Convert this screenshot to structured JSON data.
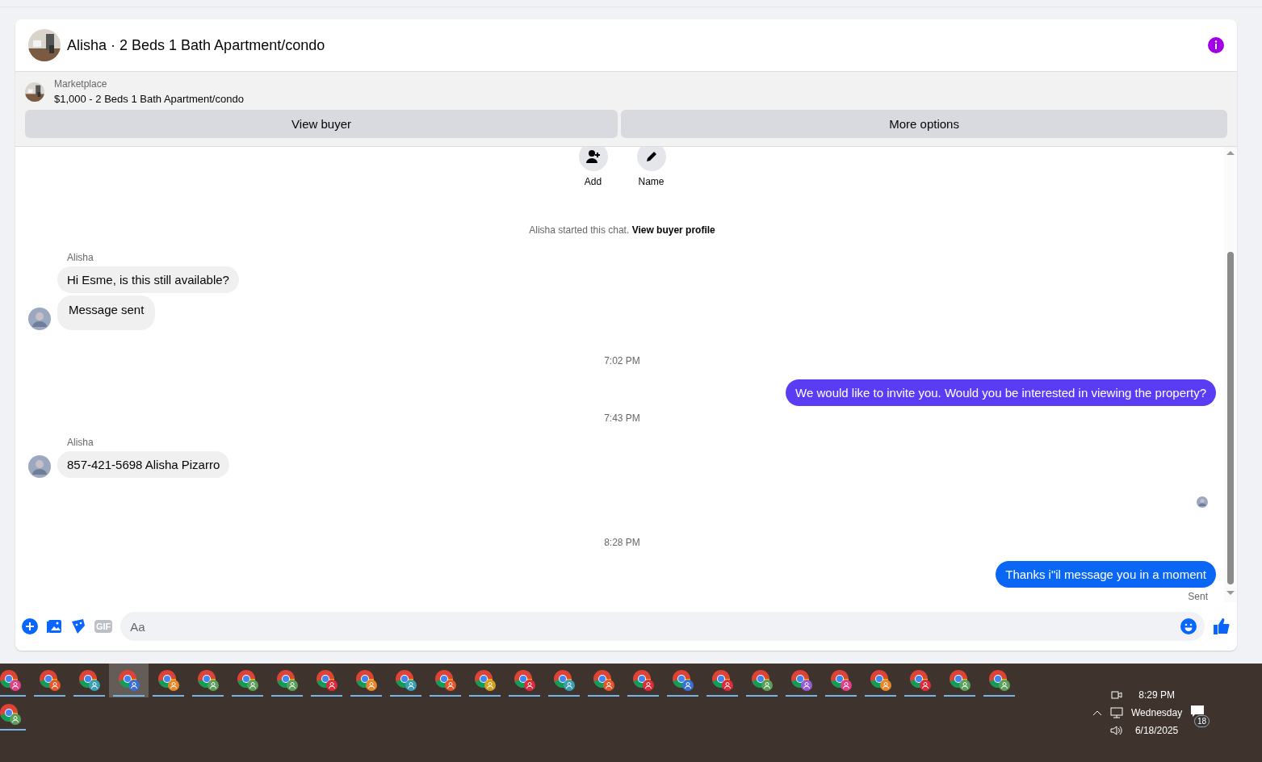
{
  "header": {
    "title": "Alisha · 2 Beds 1 Bath Apartment/condo"
  },
  "listing": {
    "source": "Marketplace",
    "summary": "$1,000 - 2 Beds 1 Bath Apartment/condo",
    "buttons": [
      "View buyer",
      "More options"
    ]
  },
  "chat_actions": [
    "Add",
    "Name"
  ],
  "messages": [
    {
      "kind": "system",
      "text": "Alisha started this chat.",
      "link": "View buyer profile"
    },
    {
      "kind": "incoming",
      "sender": "Alisha",
      "bubbles": [
        "Hi Esme, is this still available?",
        "Message sent"
      ]
    },
    {
      "kind": "time",
      "text": "7:02 PM"
    },
    {
      "kind": "outgoing",
      "text": "We would like to invite you. Would you be interested in viewing the property?",
      "color": "#5b3cf5"
    },
    {
      "kind": "time",
      "text": "7:43 PM"
    },
    {
      "kind": "incoming",
      "sender": "Alisha",
      "bubbles": [
        "857-421-5698 Alisha Pizarro"
      ]
    },
    {
      "kind": "seen"
    },
    {
      "kind": "time",
      "text": "8:28 PM"
    },
    {
      "kind": "outgoing",
      "text": "Thanks i\"il message you in a moment",
      "color": "#0a66f5",
      "status": "Sent"
    }
  ],
  "composer": {
    "placeholder": "Aa",
    "gif": "GIF"
  },
  "taskbar": {
    "apps": [
      {
        "color": "#e0408a",
        "selected": false
      },
      {
        "color": "#e8552a",
        "selected": false
      },
      {
        "color": "#3a9fb5",
        "selected": false
      },
      {
        "color": "#3b6fd8",
        "selected": true
      },
      {
        "color": "#e8862a",
        "selected": false
      },
      {
        "color": "#5aa05a",
        "selected": false
      },
      {
        "color": "#5aa05a",
        "selected": false
      },
      {
        "color": "#5aa05a",
        "selected": false
      },
      {
        "color": "#e02a3a",
        "selected": false
      },
      {
        "color": "#e8862a",
        "selected": false
      },
      {
        "color": "#3a9fb5",
        "selected": false
      },
      {
        "color": "#e8552a",
        "selected": false
      },
      {
        "color": "#d4a020",
        "selected": false
      },
      {
        "color": "#e02a3a",
        "selected": false
      },
      {
        "color": "#3a9fb5",
        "selected": false
      },
      {
        "color": "#e8552a",
        "selected": false
      },
      {
        "color": "#e02a3a",
        "selected": false
      },
      {
        "color": "#3b6fd8",
        "selected": false
      },
      {
        "color": "#e02a3a",
        "selected": false
      },
      {
        "color": "#5aa05a",
        "selected": false
      },
      {
        "color": "#9a5ad8",
        "selected": false
      },
      {
        "color": "#e0408a",
        "selected": false
      },
      {
        "color": "#e8862a",
        "selected": false
      },
      {
        "color": "#e02a3a",
        "selected": false
      },
      {
        "color": "#5aa05a",
        "selected": false
      },
      {
        "color": "#5aa05a",
        "selected": false
      }
    ],
    "second_row": [
      {
        "color": "#5aa05a",
        "selected": false
      }
    ],
    "time": "8:29 PM",
    "day": "Wednesday",
    "date": "6/18/2025",
    "notifications": "18"
  }
}
